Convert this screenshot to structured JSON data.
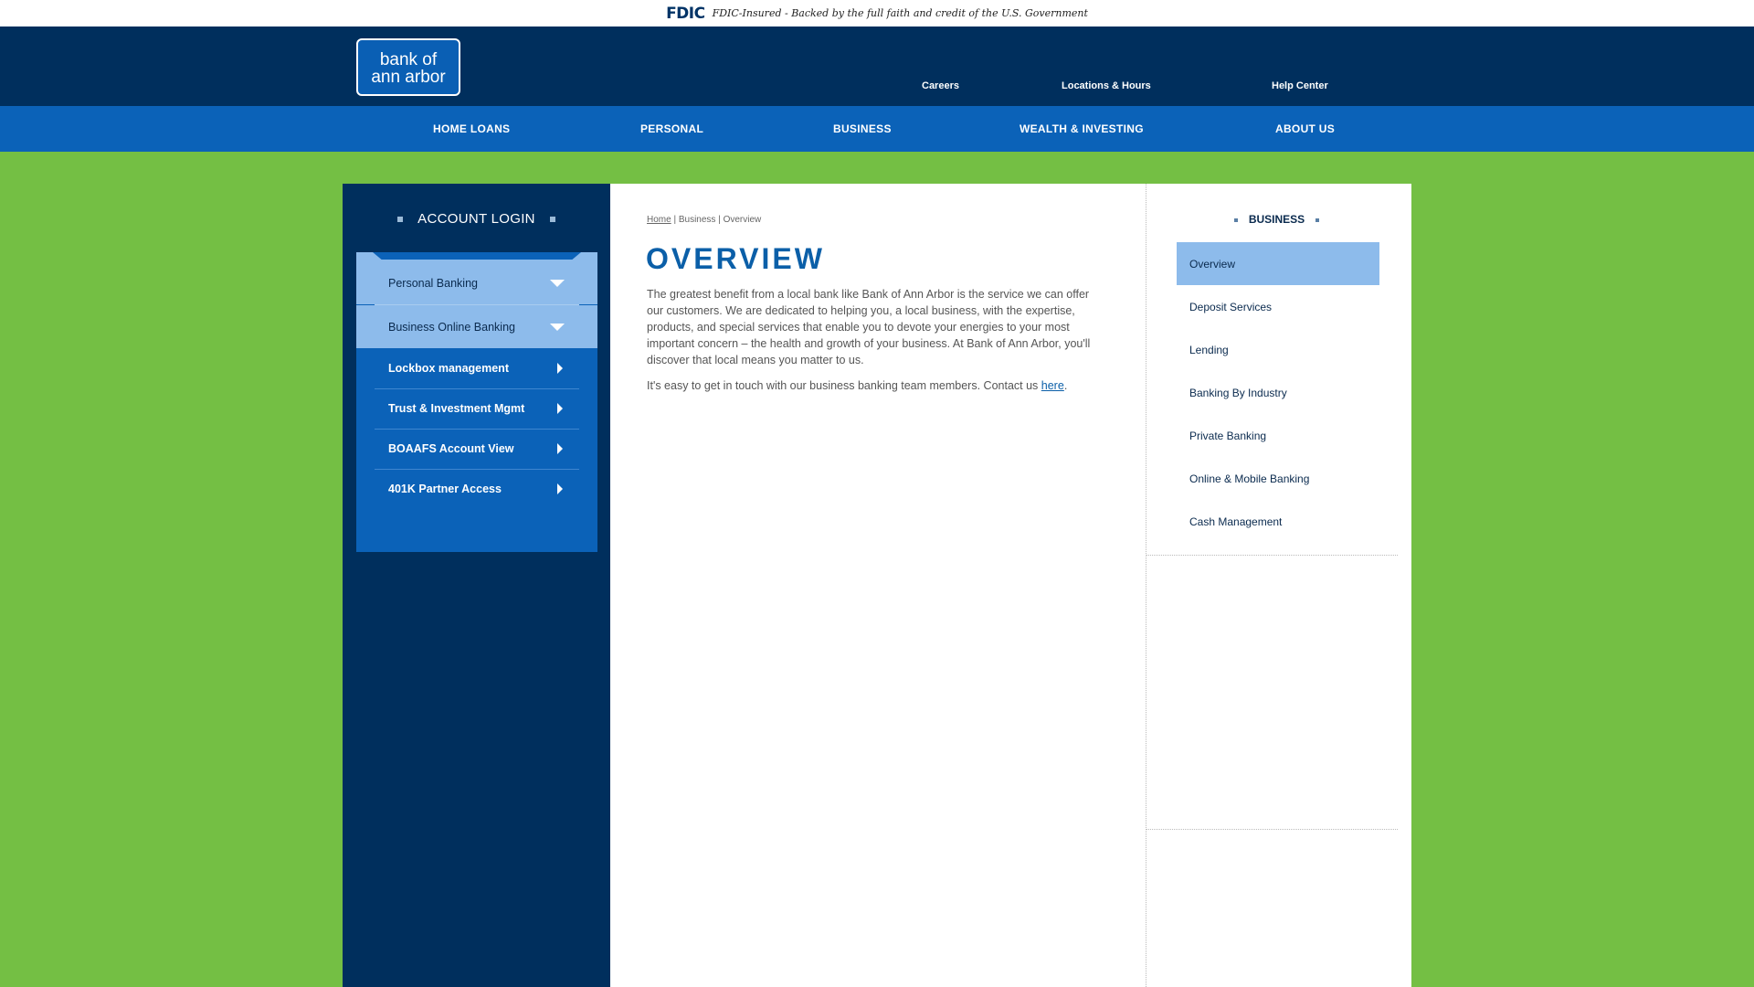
{
  "fdic": {
    "logo": "FDIC",
    "text": "FDIC-Insured - Backed by the full faith and credit of the U.S. Government"
  },
  "brand": {
    "logo_line1": "bank of",
    "logo_line2": "ann arbor"
  },
  "utility_nav": [
    {
      "label": "Careers"
    },
    {
      "label": "Locations & Hours"
    },
    {
      "label": "Help Center"
    }
  ],
  "main_nav": [
    {
      "label": "HOME LOANS"
    },
    {
      "label": "PERSONAL"
    },
    {
      "label": "BUSINESS"
    },
    {
      "label": "WEALTH & INVESTING"
    },
    {
      "label": "ABOUT US"
    }
  ],
  "login": {
    "title": "ACCOUNT LOGIN",
    "accordion": [
      {
        "label": "Personal Banking"
      },
      {
        "label": "Business Online Banking"
      }
    ],
    "links": [
      {
        "label": "Lockbox management"
      },
      {
        "label": "Trust & Investment Mgmt"
      },
      {
        "label": "BOAAFS Account View"
      },
      {
        "label": "401K Partner Access"
      }
    ]
  },
  "breadcrumb": {
    "home": "Home",
    "sep1": " | ",
    "section": "Business",
    "sep2": " | ",
    "current": "Overview"
  },
  "content": {
    "title": "OVERVIEW",
    "paragraph1": "The greatest benefit from a local bank like Bank of Ann Arbor is the service we can offer our customers. We are dedicated to helping you, a local business, with the expertise, products, and special services that enable you to devote your energies to your most important concern – the health and growth of your business. At Bank of Ann Arbor, you'll discover that local means you matter to us.",
    "paragraph2_prefix": "It's easy to get in touch with our business banking team members. Contact us ",
    "paragraph2_link": "here",
    "paragraph2_suffix": "."
  },
  "subnav": {
    "title": "BUSINESS",
    "items": [
      {
        "label": "Overview",
        "active": true
      },
      {
        "label": "Deposit Services"
      },
      {
        "label": "Lending"
      },
      {
        "label": "Banking By Industry"
      },
      {
        "label": "Private Banking"
      },
      {
        "label": "Online & Mobile Banking"
      },
      {
        "label": "Cash Management"
      }
    ]
  },
  "colors": {
    "fdic_bar": "#ffffff",
    "header": "#002f5d",
    "nav": "#0b62b8",
    "page_background": "#74bf44",
    "accent_light": "#8dbbeb",
    "title_blue": "#0b5fa8"
  }
}
